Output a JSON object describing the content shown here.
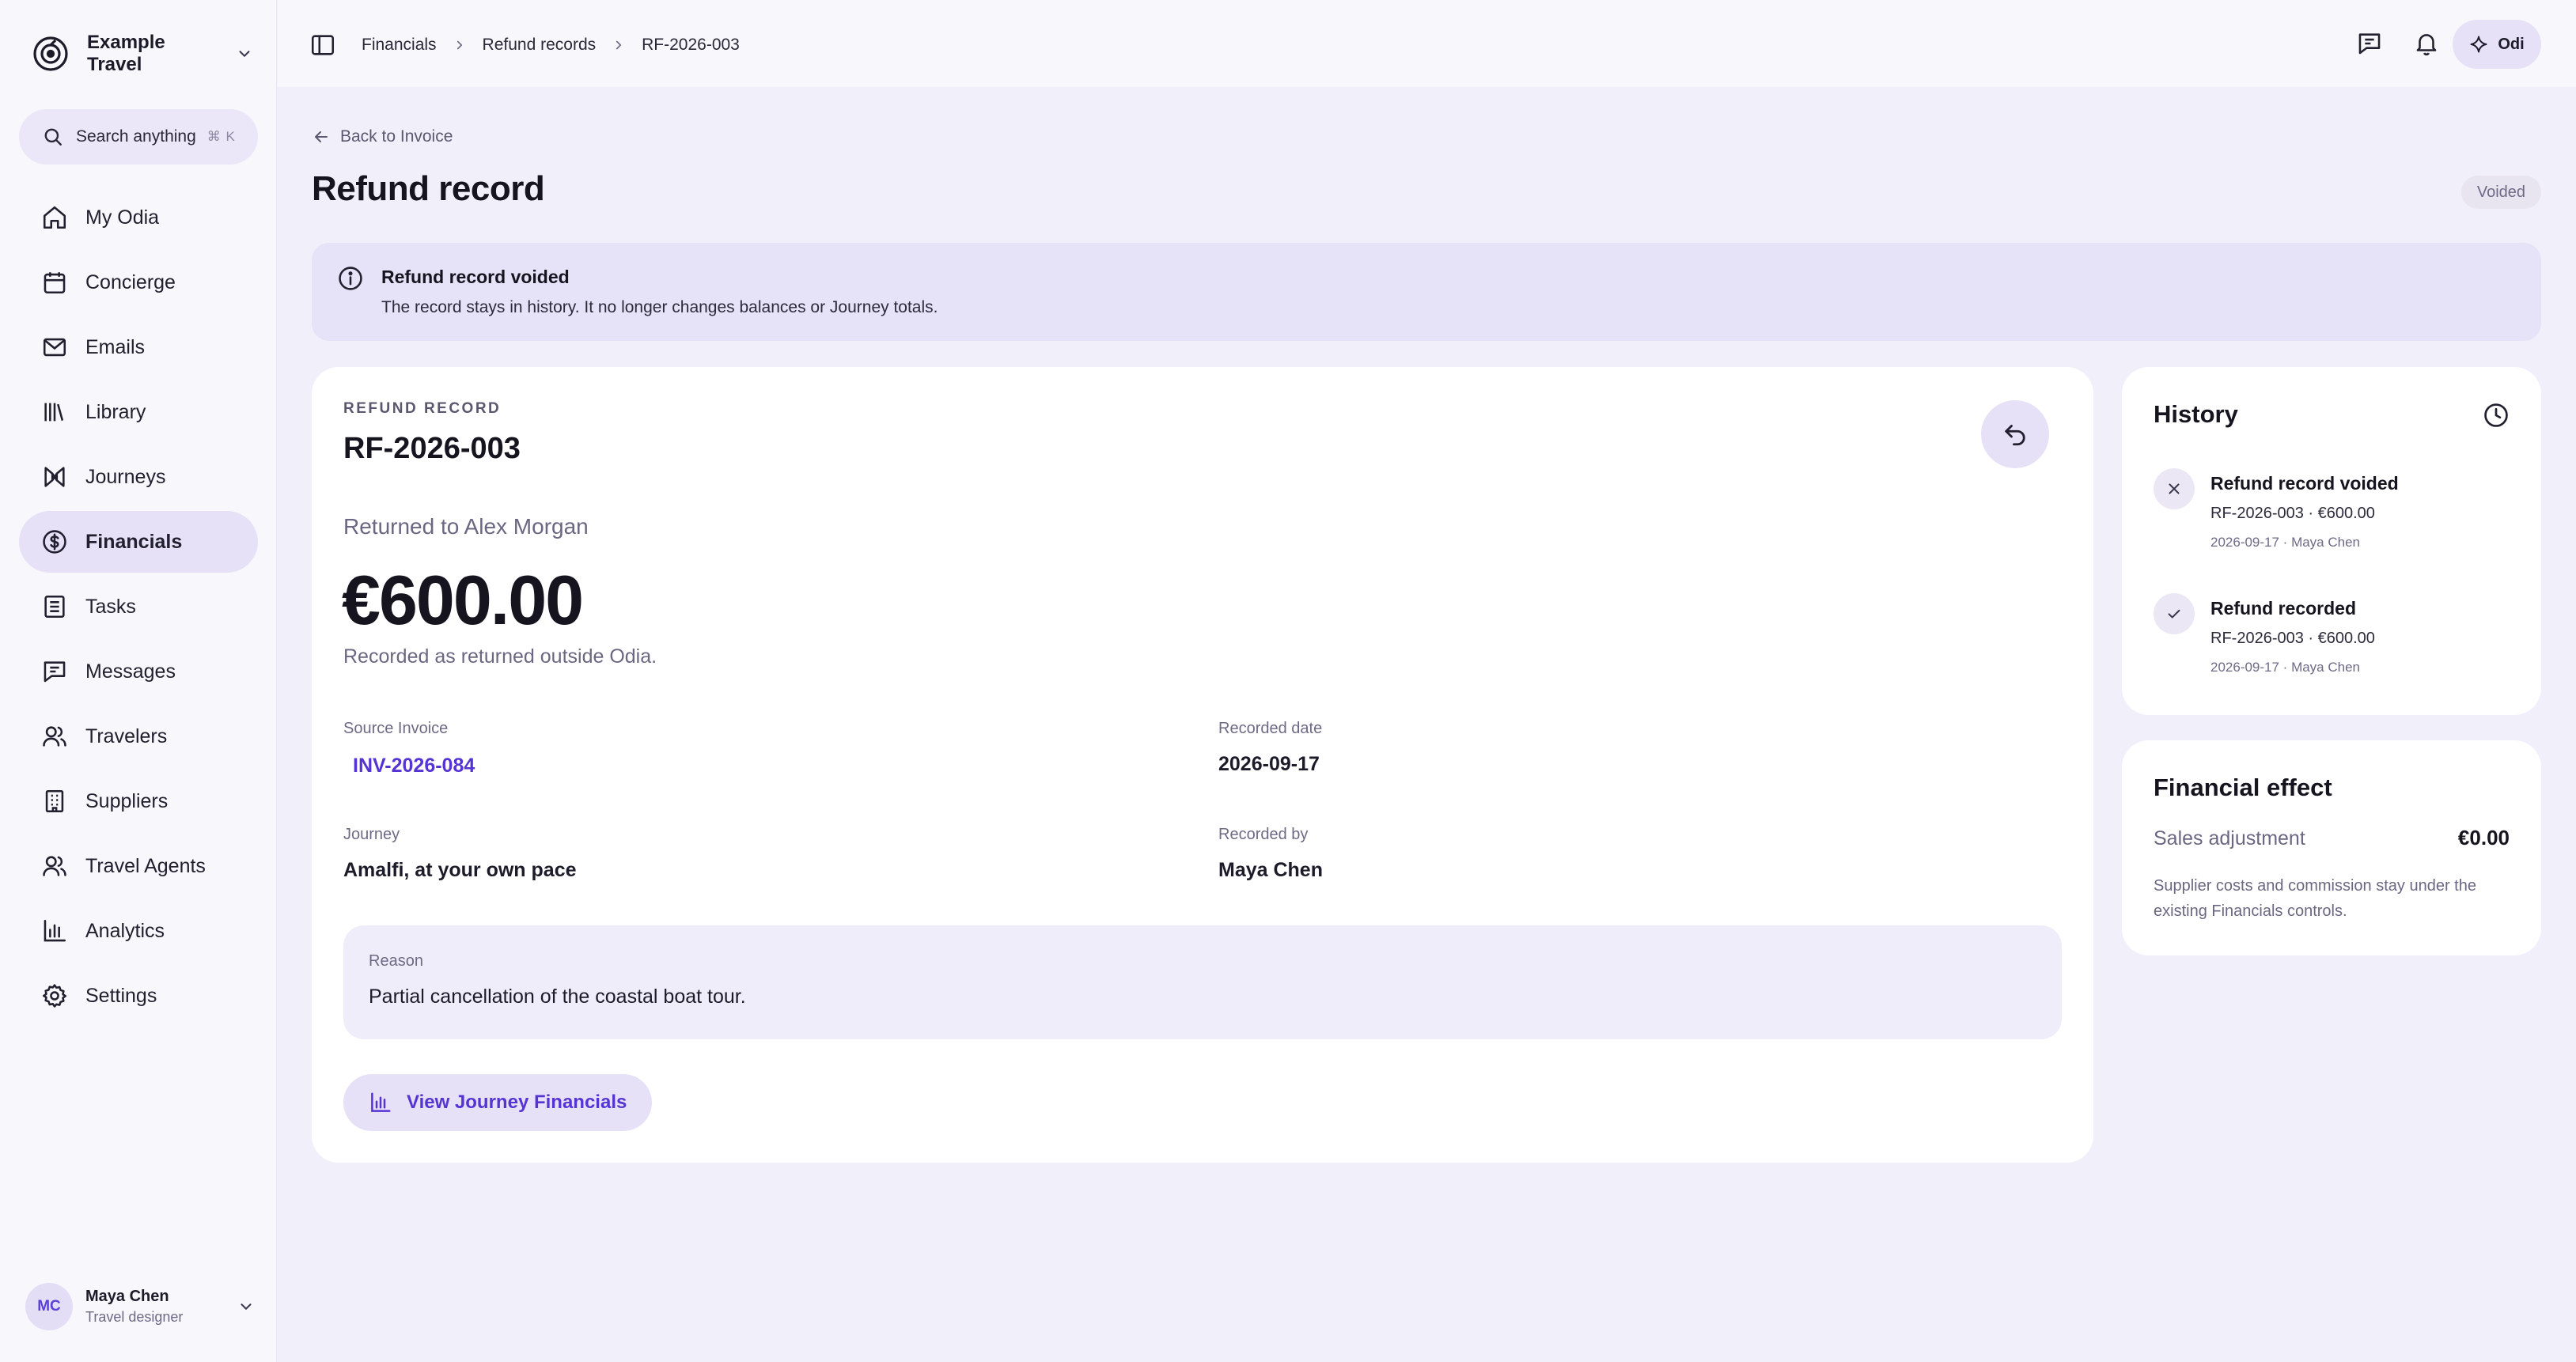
{
  "workspace": {
    "name": "Example Travel"
  },
  "search": {
    "label": "Search anything",
    "shortcut": "⌘ K"
  },
  "sidebar": {
    "items": [
      {
        "label": "My Odia",
        "icon": "home-icon"
      },
      {
        "label": "Concierge",
        "icon": "calendar-icon"
      },
      {
        "label": "Emails",
        "icon": "mail-icon"
      },
      {
        "label": "Library",
        "icon": "library-icon"
      },
      {
        "label": "Journeys",
        "icon": "journeys-icon"
      },
      {
        "label": "Financials",
        "icon": "dollar-icon",
        "active": true
      },
      {
        "label": "Tasks",
        "icon": "tasks-icon"
      },
      {
        "label": "Messages",
        "icon": "message-icon"
      },
      {
        "label": "Travelers",
        "icon": "users-icon"
      },
      {
        "label": "Suppliers",
        "icon": "building-icon"
      },
      {
        "label": "Travel Agents",
        "icon": "agents-icon"
      },
      {
        "label": "Analytics",
        "icon": "bar-chart-icon"
      },
      {
        "label": "Settings",
        "icon": "gear-icon"
      }
    ]
  },
  "user": {
    "initials": "MC",
    "name": "Maya Chen",
    "role": "Travel designer"
  },
  "breadcrumb": {
    "items": [
      "Financials",
      "Refund records",
      "RF-2026-003"
    ]
  },
  "topbar": {
    "assistant_label": "Odi"
  },
  "page": {
    "back_label": "Back to Invoice",
    "title": "Refund record",
    "status": "Voided"
  },
  "banner": {
    "title": "Refund record voided",
    "text": "The record stays in history. It no longer changes balances or Journey totals."
  },
  "record": {
    "eyebrow": "REFUND RECORD",
    "id": "RF-2026-003",
    "returned_to": "Returned to Alex Morgan",
    "amount": "€600.00",
    "note": "Recorded as returned outside Odia.",
    "fields": {
      "source_invoice_label": "Source Invoice",
      "source_invoice_value": "INV-2026-084",
      "recorded_date_label": "Recorded date",
      "recorded_date_value": "2026-09-17",
      "journey_label": "Journey",
      "journey_value": "Amalfi, at your own pace",
      "recorded_by_label": "Recorded by",
      "recorded_by_value": "Maya Chen"
    },
    "reason_label": "Reason",
    "reason_text": "Partial cancellation of the coastal boat tour.",
    "action_label": "View Journey Financials"
  },
  "history": {
    "title": "History",
    "items": [
      {
        "title": "Refund record voided",
        "detail": "RF-2026-003 · €600.00",
        "meta": "2026-09-17 · Maya Chen",
        "icon": "x-icon"
      },
      {
        "title": "Refund recorded",
        "detail": "RF-2026-003 · €600.00",
        "meta": "2026-09-17 · Maya Chen",
        "icon": "check-icon"
      }
    ]
  },
  "financial_effect": {
    "title": "Financial effect",
    "label": "Sales adjustment",
    "value": "€0.00",
    "note": "Supplier costs and commission stay under the existing Financials controls."
  },
  "colors": {
    "accent": "#5534d3",
    "active_nav_bg": "#e6e1f7",
    "page_bg": "#f1effa",
    "banner_bg": "#e6e2f7"
  }
}
